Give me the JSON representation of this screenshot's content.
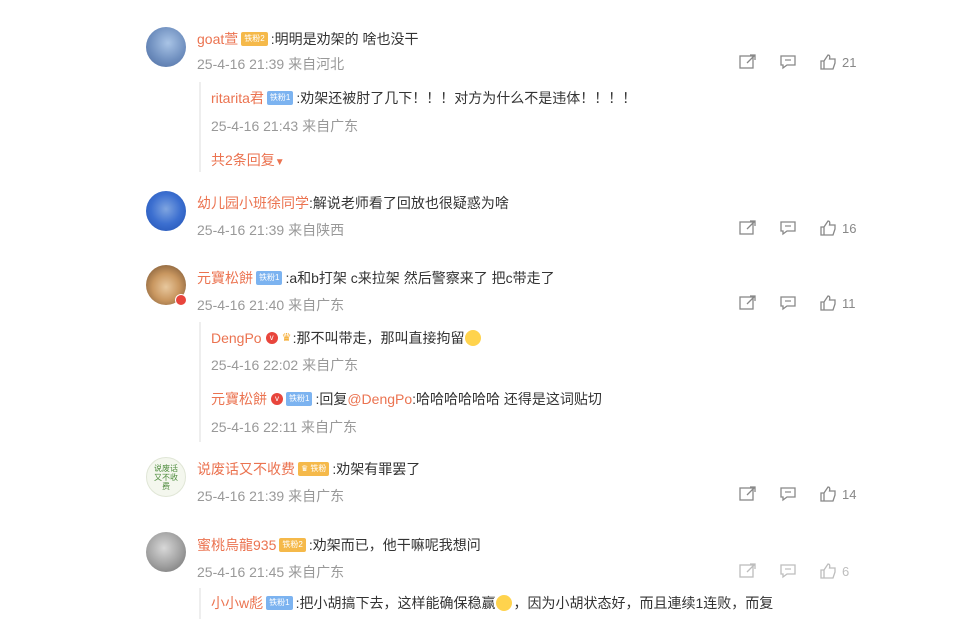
{
  "comments": [
    {
      "username": "goat萱",
      "badge": "铁粉2",
      "text": ":明明是劝架的 啥也没干",
      "time": "25-4-16 21:39 来自河北",
      "likes": "21",
      "replies": [
        {
          "username": "ritarita君",
          "badge": "铁粉1",
          "text": ":劝架还被肘了几下！！！对方为什么不是违体！！！！",
          "time": "25-4-16 21:43 来自广东"
        }
      ],
      "more_replies": "共2条回复"
    },
    {
      "username": "幼儿园小班徐同学",
      "text": ":解说老师看了回放也很疑惑为啥",
      "time": "25-4-16 21:39 来自陕西",
      "likes": "16"
    },
    {
      "username": "元寶松餅",
      "badge": "铁粉1",
      "text": ":a和b打架 c来拉架 然后警察来了 把c带走了",
      "time": "25-4-16 21:40 来自广东",
      "likes": "11",
      "replies": [
        {
          "username": "DengPo",
          "text": ":那不叫带走，那叫直接拘留",
          "time": "25-4-16 22:02 来自广东"
        },
        {
          "username": "元寶松餅",
          "badge": "铁粉1",
          "text_prefix": ":回复",
          "mention": "@DengPo",
          "text": ":哈哈哈哈哈哈 还得是这词贴切",
          "time": "25-4-16 22:11 来自广东"
        }
      ]
    },
    {
      "username": "说废话又不收费",
      "badge": "铁粉",
      "text": ":劝架有罪罢了",
      "time": "25-4-16 21:39 来自广东",
      "likes": "14",
      "avatar_text": "说废话 又不收费"
    },
    {
      "username": "蜜桃烏龍935",
      "badge": "铁粉2",
      "text": ":劝架而已，他干嘛呢我想问",
      "time": "25-4-16 21:45 来自广东",
      "likes": "6",
      "replies": [
        {
          "username": "小小w彪",
          "badge": "铁粉1",
          "text": ":把小胡搞下去，这样能确保稳赢",
          "text2": "，因为小胡状态好，而且連续1连败，而复"
        }
      ]
    }
  ],
  "colors": {
    "username": "#eb7350",
    "meta": "#999999",
    "text": "#333333"
  },
  "icons": [
    "share-icon",
    "comment-icon",
    "like-icon",
    "chevron-down-icon"
  ]
}
